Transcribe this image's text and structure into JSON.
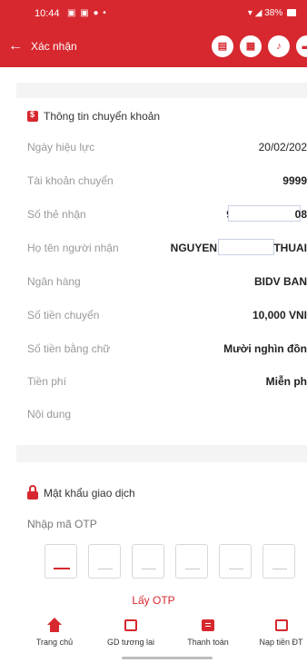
{
  "status_bar": {
    "time": "10:44",
    "battery": "38%"
  },
  "header": {
    "title": "Xác nhận",
    "back_icon": "arrow-left-icon",
    "icons": [
      "bus-icon",
      "qr-code-icon",
      "bell-icon",
      "chat-icon"
    ]
  },
  "transfer_info": {
    "heading": "Thông tin chuyển khoản",
    "rows": [
      {
        "label": "Ngày hiệu lực",
        "value": "20/02/202"
      },
      {
        "label": "Tài khoản chuyển",
        "value": "9999"
      },
      {
        "label": "Số thẻ nhận",
        "value_left": "9704",
        "value_right": "08"
      },
      {
        "label": "Họ tên người nhận",
        "value_left": "NGUYEN",
        "value_right": "THUAI"
      },
      {
        "label": "Ngân hàng",
        "value": "BIDV BAN"
      },
      {
        "label": "Số tiền chuyển",
        "value": "10,000 VNI"
      },
      {
        "label": "Số tiền bằng chữ",
        "value": "Mười nghìn đồn"
      },
      {
        "label": "Tiền phí",
        "value": "Miễn ph"
      },
      {
        "label": "Nội dung",
        "value": ""
      }
    ]
  },
  "otp": {
    "heading": "Mật khẩu giao dịch",
    "label": "Nhập mã OTP",
    "get_otp": "Lấy OTP"
  },
  "bottom_nav": {
    "tabs": [
      {
        "label": "Trang chủ",
        "icon": "home-icon"
      },
      {
        "label": "GD tương lai",
        "icon": "calendar-icon"
      },
      {
        "label": "Thanh toán",
        "icon": "bill-icon"
      },
      {
        "label": "Nạp tiền ĐT",
        "icon": "phone-topup-icon"
      }
    ]
  },
  "colors": {
    "brand_red": "#d7282f",
    "label_gray": "#9a9a9a",
    "band_gray": "#f4f4f4"
  }
}
